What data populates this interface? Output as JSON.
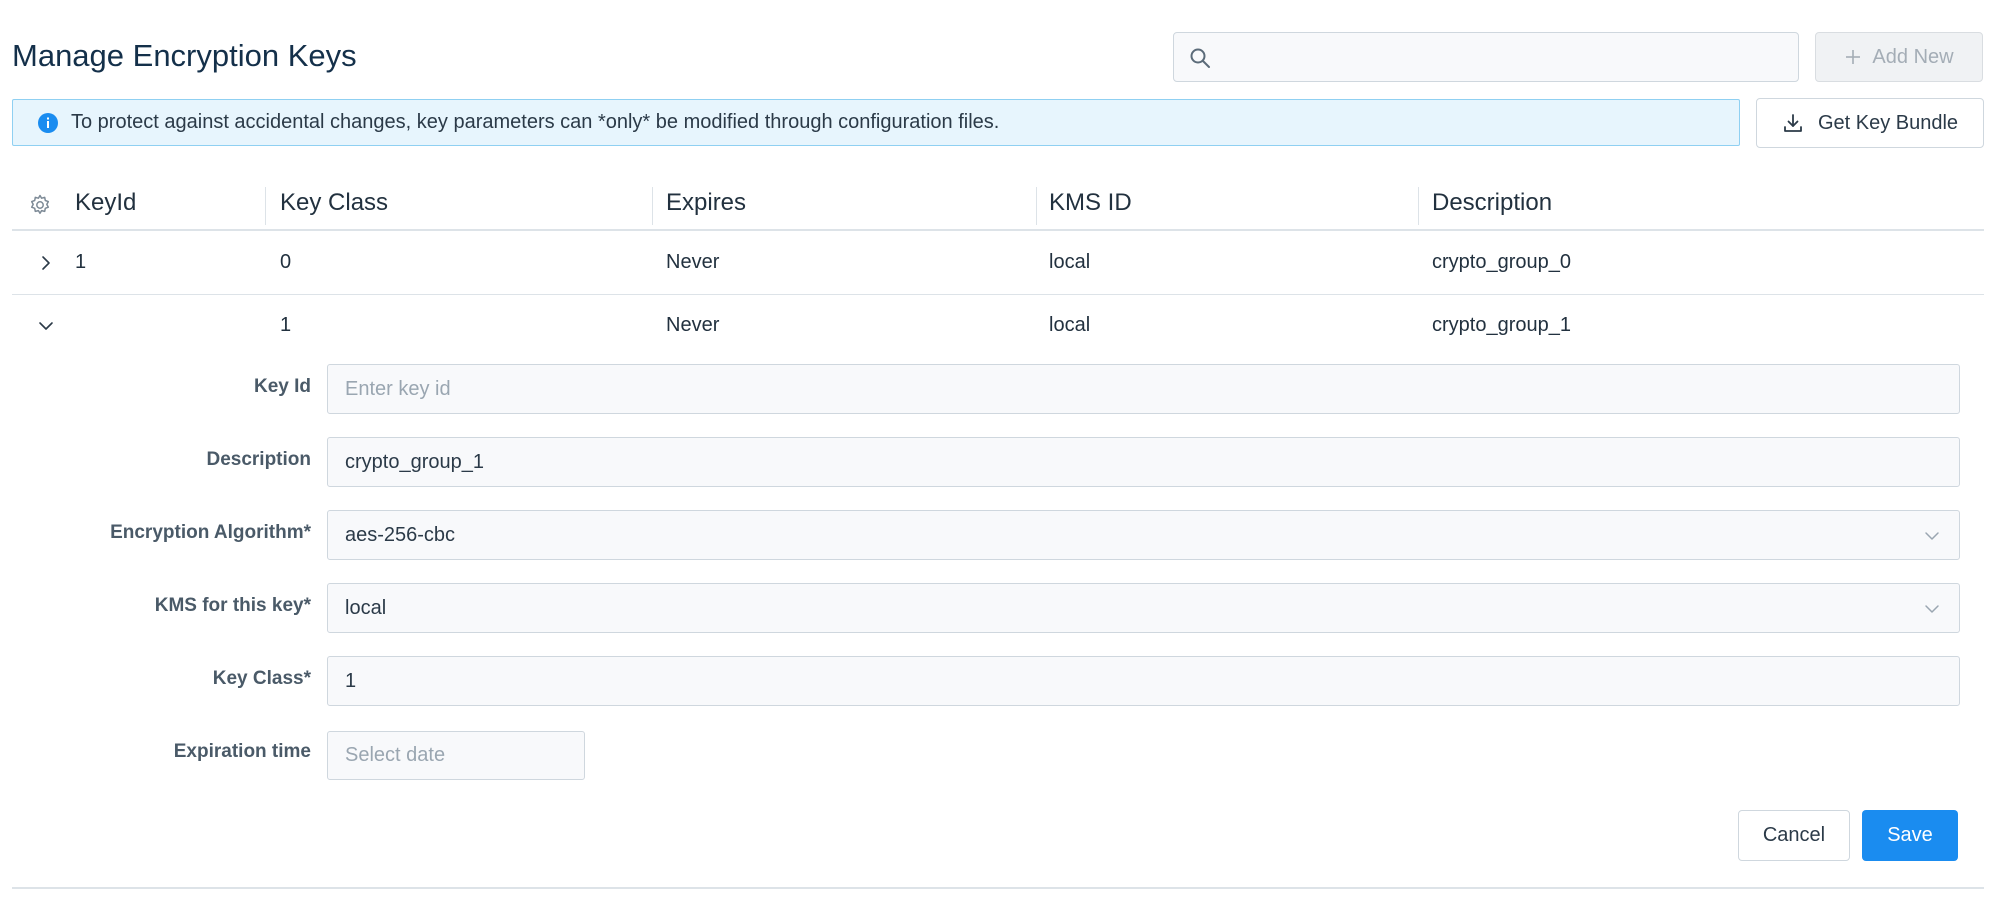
{
  "page": {
    "title": "Manage Encryption Keys"
  },
  "toolbar": {
    "search_placeholder": "",
    "add_new_label": "Add New",
    "get_bundle_label": "Get Key Bundle"
  },
  "banner": {
    "text": "To protect against accidental changes, key parameters can *only* be modified through configuration files."
  },
  "table": {
    "columns": [
      "KeyId",
      "Key Class",
      "Expires",
      "KMS ID",
      "Description"
    ],
    "rows": [
      {
        "key_id": "1",
        "key_class": "0",
        "expires": "Never",
        "kms_id": "local",
        "description": "crypto_group_0",
        "expanded": false
      },
      {
        "key_id": "",
        "key_class": "1",
        "expires": "Never",
        "kms_id": "local",
        "description": "crypto_group_1",
        "expanded": true
      }
    ]
  },
  "form": {
    "key_id": {
      "label": "Key Id",
      "value": "",
      "placeholder": "Enter key id"
    },
    "description": {
      "label": "Description",
      "value": "crypto_group_1"
    },
    "algorithm": {
      "label": "Encryption Algorithm*",
      "value": "aes-256-cbc"
    },
    "kms": {
      "label": "KMS for this key*",
      "value": "local"
    },
    "key_class": {
      "label": "Key Class*",
      "value": "1"
    },
    "expiration": {
      "label": "Expiration time",
      "value": "",
      "placeholder": "Select date"
    },
    "cancel_label": "Cancel",
    "save_label": "Save"
  },
  "icons": {
    "search": "search-icon",
    "add": "plus-icon",
    "info": "info-icon",
    "download": "download-icon",
    "settings": "gear-icon",
    "collapsed": "chevron-right-icon",
    "expanded": "chevron-down-icon"
  },
  "colors": {
    "primary": "#1a8cf0",
    "info_bg": "#e7f5fd",
    "info_border": "#8fd0f2",
    "title": "#14304a"
  }
}
